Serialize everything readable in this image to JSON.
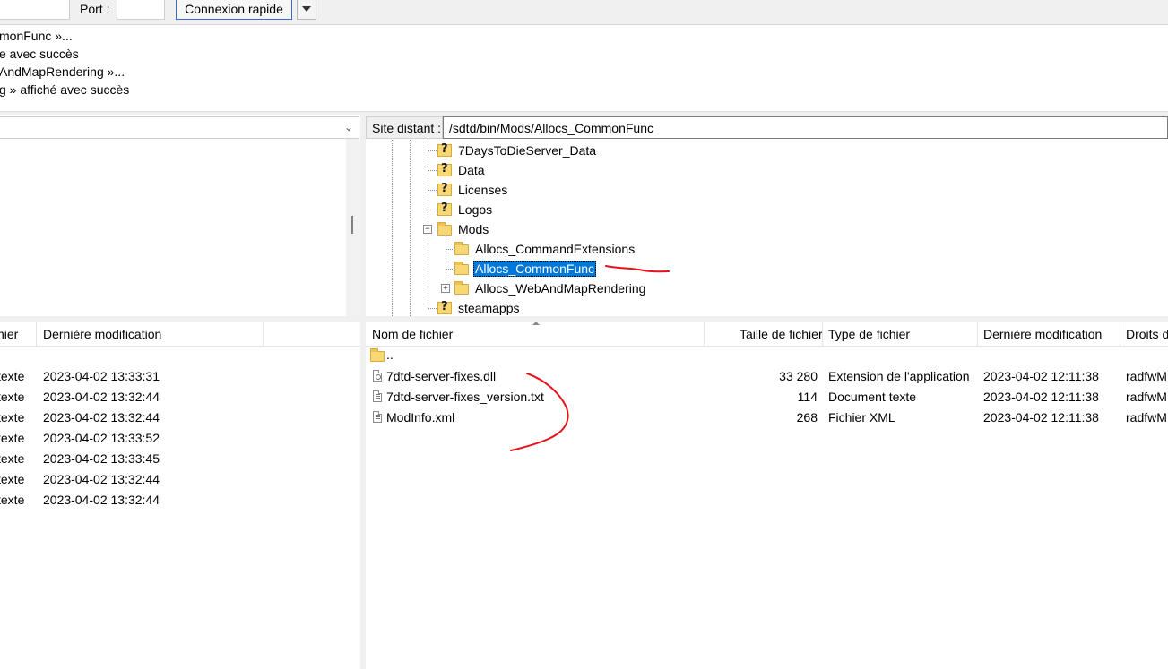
{
  "quickconnect": {
    "port_label": "Port :",
    "port_value": "",
    "connect_label": "Connexion rapide"
  },
  "log": [
    "monFunc »...",
    "e avec succès",
    "AndMapRendering »...",
    "g » affiché avec succès"
  ],
  "local_tree": {
    "path": ""
  },
  "remote": {
    "site_label": "Site distant :",
    "path": "/sdtd/bin/Mods/Allocs_CommonFunc",
    "tree": [
      {
        "label": "7DaysToDieServer_Data",
        "icon": "question-folder-icon"
      },
      {
        "label": "Data",
        "icon": "question-folder-icon"
      },
      {
        "label": "Licenses",
        "icon": "question-folder-icon"
      },
      {
        "label": "Logos",
        "icon": "question-folder-icon"
      },
      {
        "label": "Mods",
        "icon": "folder-icon"
      },
      {
        "label": "Allocs_CommandExtensions",
        "icon": "folder-icon"
      },
      {
        "label": "Allocs_CommonFunc",
        "icon": "folder-icon",
        "selected": true
      },
      {
        "label": "Allocs_WebAndMapRendering",
        "icon": "folder-icon"
      },
      {
        "label": "steamapps",
        "icon": "question-folder-icon"
      }
    ],
    "columns": [
      "Nom de fichier",
      "Taille de fichier",
      "Type de fichier",
      "Dernière modification",
      "Droits d"
    ],
    "parent_dir": "..",
    "files": [
      {
        "name": "7dtd-server-fixes.dll",
        "size": "33 280",
        "type": "Extension de l'application",
        "modified": "2023-04-02 12:11:38",
        "perms": "radfwM",
        "icon": "dll-file-icon"
      },
      {
        "name": "7dtd-server-fixes_version.txt",
        "size": "114",
        "type": "Document texte",
        "modified": "2023-04-02 12:11:38",
        "perms": "radfwM",
        "icon": "text-file-icon"
      },
      {
        "name": "ModInfo.xml",
        "size": "268",
        "type": "Fichier XML",
        "modified": "2023-04-02 12:11:38",
        "perms": "radfwM",
        "icon": "text-file-icon"
      }
    ]
  },
  "local_list": {
    "columns": [
      "hier",
      "Dernière modification"
    ],
    "rows": [
      {
        "type": "texte",
        "modified": "2023-04-02 13:33:31"
      },
      {
        "type": "texte",
        "modified": "2023-04-02 13:32:44"
      },
      {
        "type": "texte",
        "modified": "2023-04-02 13:32:44"
      },
      {
        "type": "texte",
        "modified": "2023-04-02 13:33:52"
      },
      {
        "type": "texte",
        "modified": "2023-04-02 13:33:45"
      },
      {
        "type": "texte",
        "modified": "2023-04-02 13:32:44"
      },
      {
        "type": "texte",
        "modified": "2023-04-02 13:32:44"
      }
    ]
  },
  "colors": {
    "selection": "#0078d7",
    "annotation": "#e8101a",
    "connect_border": "#2f6fcf"
  }
}
